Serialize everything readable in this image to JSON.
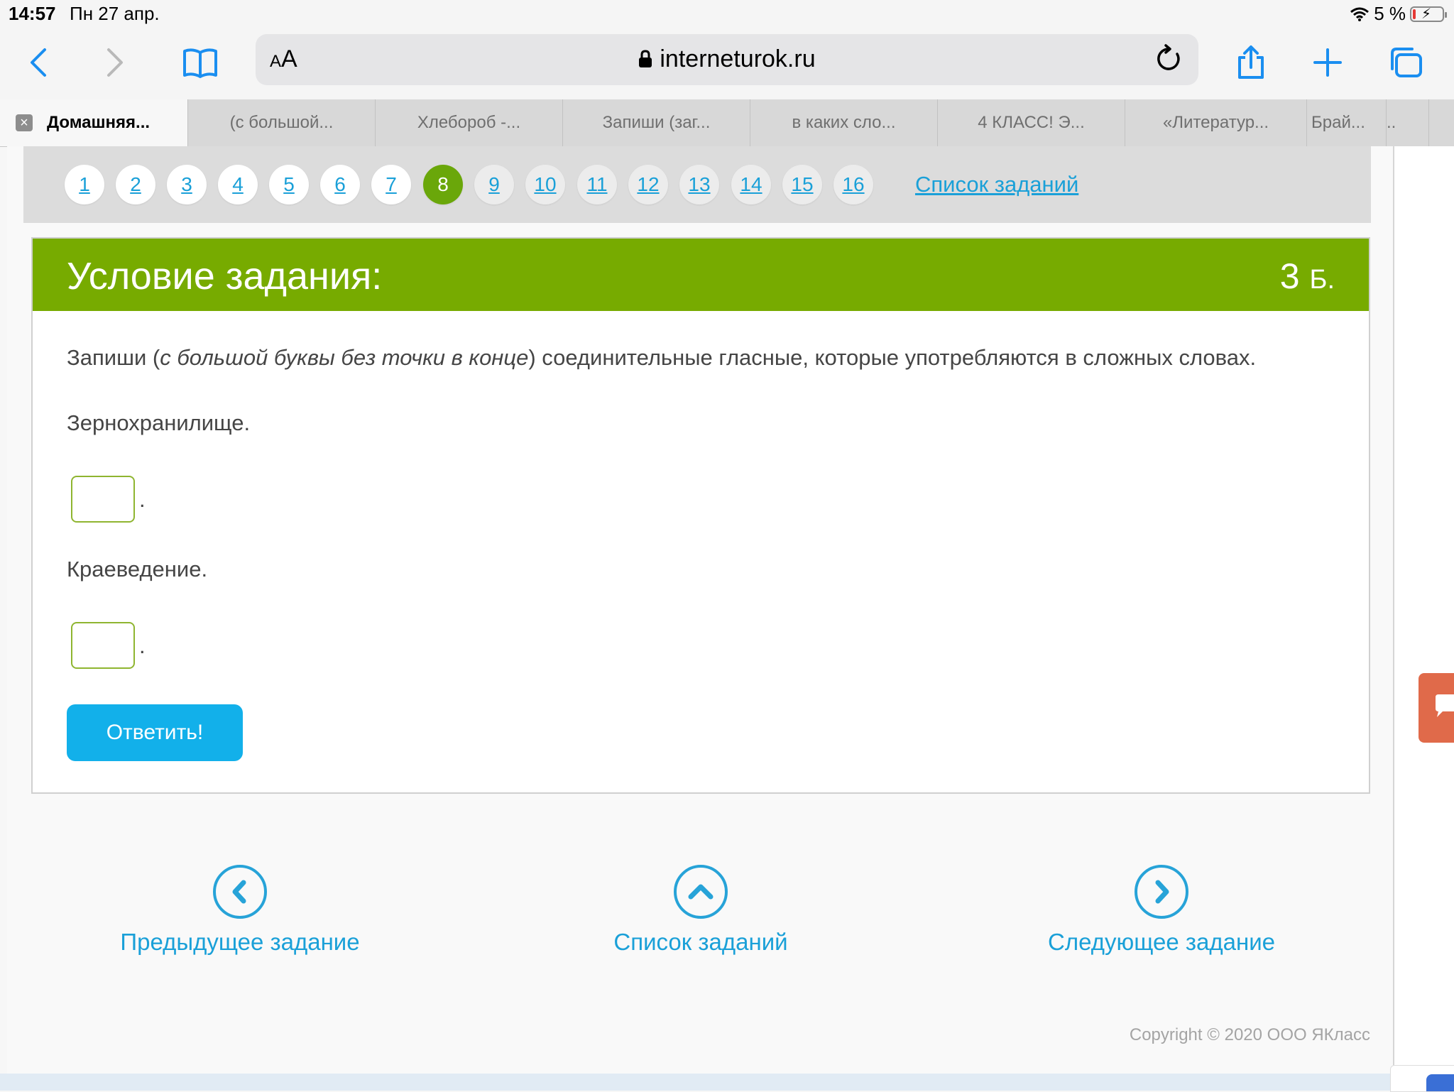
{
  "status": {
    "time": "14:57",
    "date": "Пн 27 апр.",
    "battery": "5 %"
  },
  "toolbar": {
    "aa_small": "A",
    "aa_big": "A",
    "url": "interneturok.ru"
  },
  "tabs": [
    "Домашняя...",
    "(с большой...",
    "Хлебороб -...",
    "Запиши (заг...",
    "в каких сло...",
    "4 КЛАСС! Э...",
    "«Литератур...",
    "Брай...",
    ".."
  ],
  "pagination": {
    "pages": [
      "1",
      "2",
      "3",
      "4",
      "5",
      "6",
      "7",
      "8",
      "9",
      "10",
      "11",
      "12",
      "13",
      "14",
      "15",
      "16"
    ],
    "active_index": 7,
    "list_link": "Список заданий"
  },
  "task": {
    "title": "Условие задания:",
    "score_value": "3",
    "score_unit": "Б.",
    "text_before": "Запиши (",
    "text_italic": "с большой буквы без точки в конце",
    "text_after": ") соединительные гласные, которые употребляются в сложных словах.",
    "words": [
      "Зернохранилище.",
      "Краеведение."
    ],
    "answers": [
      "",
      ""
    ],
    "dot": ".",
    "submit": "Ответить!"
  },
  "footer_nav": {
    "prev": "Предыдущее задание",
    "list": "Список заданий",
    "next": "Следующее задание"
  },
  "copyright": "Copyright © 2020 ООО ЯКласс",
  "colors": {
    "accent_green": "#77ab00",
    "link_blue": "#1aa0d8",
    "button_blue": "#12b0ea"
  }
}
